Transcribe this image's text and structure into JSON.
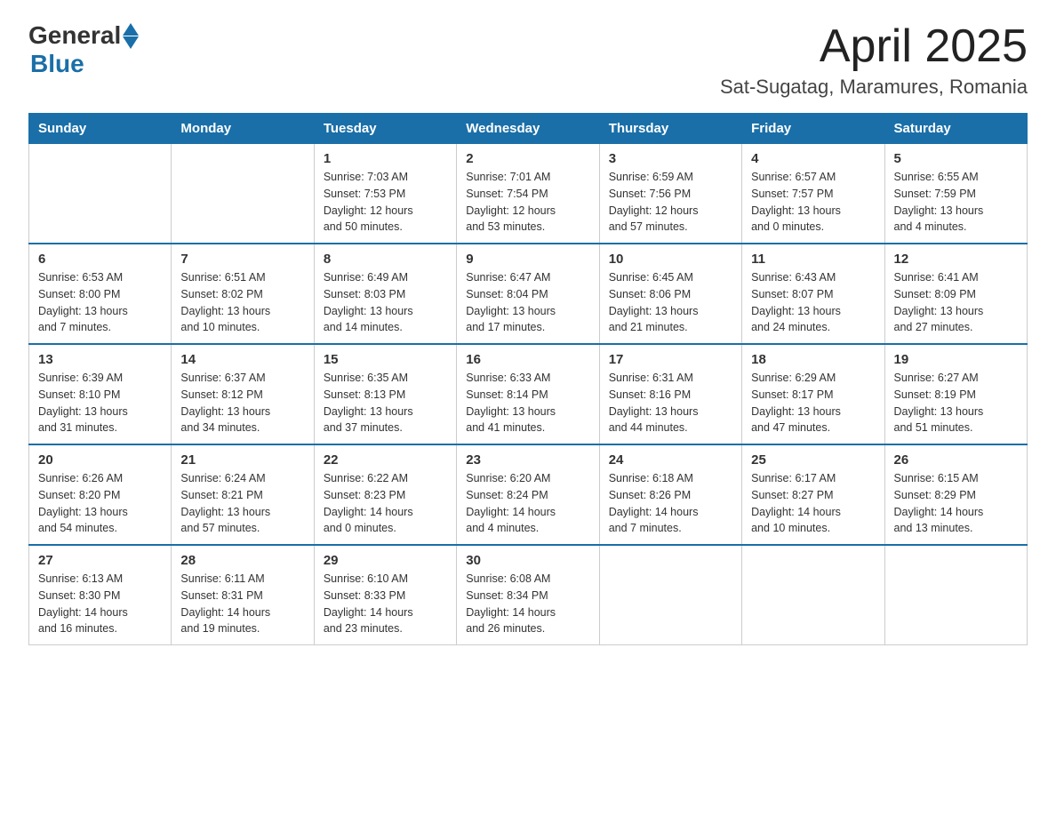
{
  "header": {
    "logo": {
      "general": "General",
      "blue": "Blue"
    },
    "month": "April 2025",
    "location": "Sat-Sugatag, Maramures, Romania"
  },
  "weekdays": [
    "Sunday",
    "Monday",
    "Tuesday",
    "Wednesday",
    "Thursday",
    "Friday",
    "Saturday"
  ],
  "weeks": [
    [
      {
        "day": "",
        "info": ""
      },
      {
        "day": "",
        "info": ""
      },
      {
        "day": "1",
        "info": "Sunrise: 7:03 AM\nSunset: 7:53 PM\nDaylight: 12 hours\nand 50 minutes."
      },
      {
        "day": "2",
        "info": "Sunrise: 7:01 AM\nSunset: 7:54 PM\nDaylight: 12 hours\nand 53 minutes."
      },
      {
        "day": "3",
        "info": "Sunrise: 6:59 AM\nSunset: 7:56 PM\nDaylight: 12 hours\nand 57 minutes."
      },
      {
        "day": "4",
        "info": "Sunrise: 6:57 AM\nSunset: 7:57 PM\nDaylight: 13 hours\nand 0 minutes."
      },
      {
        "day": "5",
        "info": "Sunrise: 6:55 AM\nSunset: 7:59 PM\nDaylight: 13 hours\nand 4 minutes."
      }
    ],
    [
      {
        "day": "6",
        "info": "Sunrise: 6:53 AM\nSunset: 8:00 PM\nDaylight: 13 hours\nand 7 minutes."
      },
      {
        "day": "7",
        "info": "Sunrise: 6:51 AM\nSunset: 8:02 PM\nDaylight: 13 hours\nand 10 minutes."
      },
      {
        "day": "8",
        "info": "Sunrise: 6:49 AM\nSunset: 8:03 PM\nDaylight: 13 hours\nand 14 minutes."
      },
      {
        "day": "9",
        "info": "Sunrise: 6:47 AM\nSunset: 8:04 PM\nDaylight: 13 hours\nand 17 minutes."
      },
      {
        "day": "10",
        "info": "Sunrise: 6:45 AM\nSunset: 8:06 PM\nDaylight: 13 hours\nand 21 minutes."
      },
      {
        "day": "11",
        "info": "Sunrise: 6:43 AM\nSunset: 8:07 PM\nDaylight: 13 hours\nand 24 minutes."
      },
      {
        "day": "12",
        "info": "Sunrise: 6:41 AM\nSunset: 8:09 PM\nDaylight: 13 hours\nand 27 minutes."
      }
    ],
    [
      {
        "day": "13",
        "info": "Sunrise: 6:39 AM\nSunset: 8:10 PM\nDaylight: 13 hours\nand 31 minutes."
      },
      {
        "day": "14",
        "info": "Sunrise: 6:37 AM\nSunset: 8:12 PM\nDaylight: 13 hours\nand 34 minutes."
      },
      {
        "day": "15",
        "info": "Sunrise: 6:35 AM\nSunset: 8:13 PM\nDaylight: 13 hours\nand 37 minutes."
      },
      {
        "day": "16",
        "info": "Sunrise: 6:33 AM\nSunset: 8:14 PM\nDaylight: 13 hours\nand 41 minutes."
      },
      {
        "day": "17",
        "info": "Sunrise: 6:31 AM\nSunset: 8:16 PM\nDaylight: 13 hours\nand 44 minutes."
      },
      {
        "day": "18",
        "info": "Sunrise: 6:29 AM\nSunset: 8:17 PM\nDaylight: 13 hours\nand 47 minutes."
      },
      {
        "day": "19",
        "info": "Sunrise: 6:27 AM\nSunset: 8:19 PM\nDaylight: 13 hours\nand 51 minutes."
      }
    ],
    [
      {
        "day": "20",
        "info": "Sunrise: 6:26 AM\nSunset: 8:20 PM\nDaylight: 13 hours\nand 54 minutes."
      },
      {
        "day": "21",
        "info": "Sunrise: 6:24 AM\nSunset: 8:21 PM\nDaylight: 13 hours\nand 57 minutes."
      },
      {
        "day": "22",
        "info": "Sunrise: 6:22 AM\nSunset: 8:23 PM\nDaylight: 14 hours\nand 0 minutes."
      },
      {
        "day": "23",
        "info": "Sunrise: 6:20 AM\nSunset: 8:24 PM\nDaylight: 14 hours\nand 4 minutes."
      },
      {
        "day": "24",
        "info": "Sunrise: 6:18 AM\nSunset: 8:26 PM\nDaylight: 14 hours\nand 7 minutes."
      },
      {
        "day": "25",
        "info": "Sunrise: 6:17 AM\nSunset: 8:27 PM\nDaylight: 14 hours\nand 10 minutes."
      },
      {
        "day": "26",
        "info": "Sunrise: 6:15 AM\nSunset: 8:29 PM\nDaylight: 14 hours\nand 13 minutes."
      }
    ],
    [
      {
        "day": "27",
        "info": "Sunrise: 6:13 AM\nSunset: 8:30 PM\nDaylight: 14 hours\nand 16 minutes."
      },
      {
        "day": "28",
        "info": "Sunrise: 6:11 AM\nSunset: 8:31 PM\nDaylight: 14 hours\nand 19 minutes."
      },
      {
        "day": "29",
        "info": "Sunrise: 6:10 AM\nSunset: 8:33 PM\nDaylight: 14 hours\nand 23 minutes."
      },
      {
        "day": "30",
        "info": "Sunrise: 6:08 AM\nSunset: 8:34 PM\nDaylight: 14 hours\nand 26 minutes."
      },
      {
        "day": "",
        "info": ""
      },
      {
        "day": "",
        "info": ""
      },
      {
        "day": "",
        "info": ""
      }
    ]
  ]
}
